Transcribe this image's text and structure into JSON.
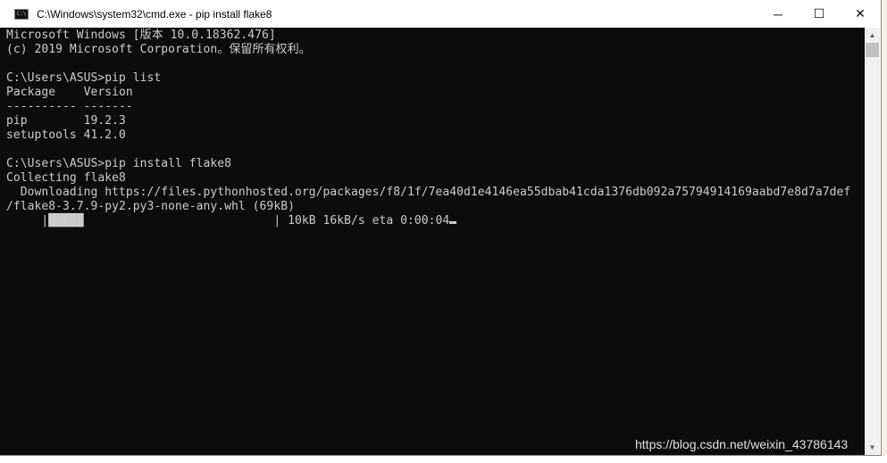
{
  "window": {
    "title": "C:\\Windows\\system32\\cmd.exe - pip  install flake8",
    "icon": "cmd-icon",
    "controls": {
      "minimize": "─",
      "maximize": "☐",
      "close": "✕"
    }
  },
  "terminal": {
    "lines": [
      "Microsoft Windows [版本 10.0.18362.476]",
      "(c) 2019 Microsoft Corporation。保留所有权利。",
      "",
      "C:\\Users\\ASUS>pip list",
      "Package    Version",
      "---------- -------",
      "pip        19.2.3",
      "setuptools 41.2.0",
      "",
      "C:\\Users\\ASUS>pip install flake8",
      "Collecting flake8",
      "  Downloading https://files.pythonhosted.org/packages/f8/1f/7ea40d1e4146ea55dbab41cda1376db092a75794914169aabd7e8d7a7def",
      "/flake8-3.7.9-py2.py3-none-any.whl (69kB)",
      "     |█████                           | 10kB 16kB/s eta 0:00:04"
    ]
  },
  "watermark": "https://blog.csdn.net/weixin_43786143"
}
